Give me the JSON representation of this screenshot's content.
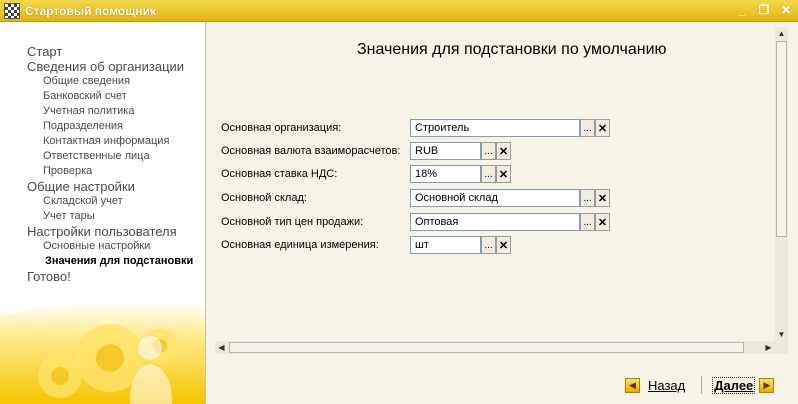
{
  "window": {
    "title": "Стартовый помощник",
    "controls": {
      "minimize": "_",
      "restore": "❐",
      "close": "✕"
    }
  },
  "sidebar": {
    "items": [
      {
        "label": "Старт",
        "level": 1
      },
      {
        "label": "Сведения об организации",
        "level": 1
      },
      {
        "label": "Общие сведения",
        "level": 2
      },
      {
        "label": "Банковский счет",
        "level": 2
      },
      {
        "label": "Учетная политика",
        "level": 2
      },
      {
        "label": "Подразделения",
        "level": 2
      },
      {
        "label": "Контактная информация",
        "level": 2
      },
      {
        "label": "Ответственные лица",
        "level": 2
      },
      {
        "label": "Проверка",
        "level": 2
      },
      {
        "label": "Общие настройки",
        "level": 1
      },
      {
        "label": "Складской учет",
        "level": 2
      },
      {
        "label": "Учет тары",
        "level": 2
      },
      {
        "label": "Настройки пользователя",
        "level": 1
      },
      {
        "label": "Основные настройки",
        "level": 2
      },
      {
        "label": "Значения для подстановки",
        "level": 2,
        "active": true
      },
      {
        "label": "Готово!",
        "level": 1
      }
    ]
  },
  "main": {
    "heading": "Значения для подстановки по умолчанию",
    "fields": [
      {
        "label": "Основная организация:",
        "value": "Строитель"
      },
      {
        "label": "Основная валюта взаиморасчетов:",
        "value": "RUB"
      },
      {
        "label": "Основная ставка НДС:",
        "value": "18%"
      },
      {
        "label": "Основной склад:",
        "value": "Основной склад"
      },
      {
        "label": "Основной тип цен продажи:",
        "value": "Оптовая"
      },
      {
        "label": "Основная единица измерения:",
        "value": "шт"
      }
    ],
    "select_button": "...",
    "clear_button": "✕"
  },
  "footer": {
    "back_label": "Назад",
    "next_label": "Далее"
  },
  "colors": {
    "titlebar": "#e2b412",
    "accent": "#f5c400"
  }
}
